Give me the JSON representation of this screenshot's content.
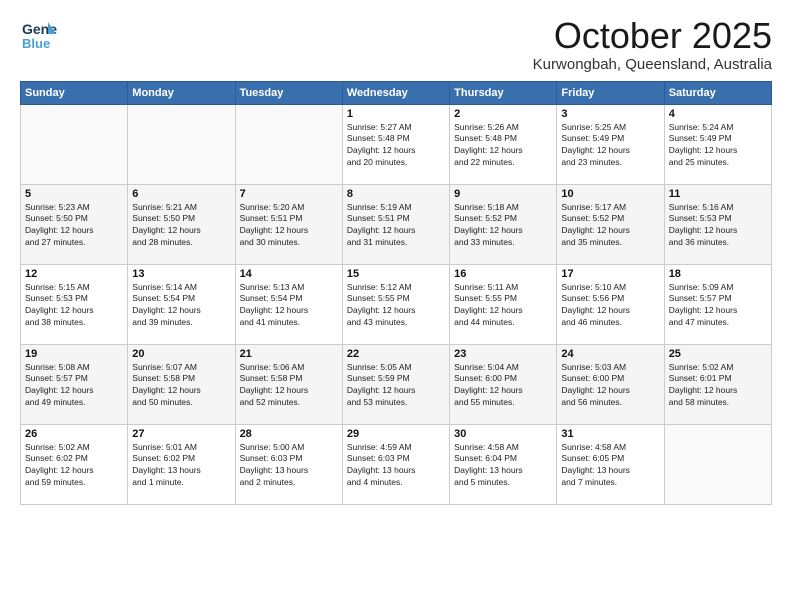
{
  "logo": {
    "general": "General",
    "blue": "Blue"
  },
  "title": "October 2025",
  "subtitle": "Kurwongbah, Queensland, Australia",
  "weekdays": [
    "Sunday",
    "Monday",
    "Tuesday",
    "Wednesday",
    "Thursday",
    "Friday",
    "Saturday"
  ],
  "weeks": [
    [
      {
        "day": "",
        "info": ""
      },
      {
        "day": "",
        "info": ""
      },
      {
        "day": "",
        "info": ""
      },
      {
        "day": "1",
        "info": "Sunrise: 5:27 AM\nSunset: 5:48 PM\nDaylight: 12 hours\nand 20 minutes."
      },
      {
        "day": "2",
        "info": "Sunrise: 5:26 AM\nSunset: 5:48 PM\nDaylight: 12 hours\nand 22 minutes."
      },
      {
        "day": "3",
        "info": "Sunrise: 5:25 AM\nSunset: 5:49 PM\nDaylight: 12 hours\nand 23 minutes."
      },
      {
        "day": "4",
        "info": "Sunrise: 5:24 AM\nSunset: 5:49 PM\nDaylight: 12 hours\nand 25 minutes."
      }
    ],
    [
      {
        "day": "5",
        "info": "Sunrise: 5:23 AM\nSunset: 5:50 PM\nDaylight: 12 hours\nand 27 minutes."
      },
      {
        "day": "6",
        "info": "Sunrise: 5:21 AM\nSunset: 5:50 PM\nDaylight: 12 hours\nand 28 minutes."
      },
      {
        "day": "7",
        "info": "Sunrise: 5:20 AM\nSunset: 5:51 PM\nDaylight: 12 hours\nand 30 minutes."
      },
      {
        "day": "8",
        "info": "Sunrise: 5:19 AM\nSunset: 5:51 PM\nDaylight: 12 hours\nand 31 minutes."
      },
      {
        "day": "9",
        "info": "Sunrise: 5:18 AM\nSunset: 5:52 PM\nDaylight: 12 hours\nand 33 minutes."
      },
      {
        "day": "10",
        "info": "Sunrise: 5:17 AM\nSunset: 5:52 PM\nDaylight: 12 hours\nand 35 minutes."
      },
      {
        "day": "11",
        "info": "Sunrise: 5:16 AM\nSunset: 5:53 PM\nDaylight: 12 hours\nand 36 minutes."
      }
    ],
    [
      {
        "day": "12",
        "info": "Sunrise: 5:15 AM\nSunset: 5:53 PM\nDaylight: 12 hours\nand 38 minutes."
      },
      {
        "day": "13",
        "info": "Sunrise: 5:14 AM\nSunset: 5:54 PM\nDaylight: 12 hours\nand 39 minutes."
      },
      {
        "day": "14",
        "info": "Sunrise: 5:13 AM\nSunset: 5:54 PM\nDaylight: 12 hours\nand 41 minutes."
      },
      {
        "day": "15",
        "info": "Sunrise: 5:12 AM\nSunset: 5:55 PM\nDaylight: 12 hours\nand 43 minutes."
      },
      {
        "day": "16",
        "info": "Sunrise: 5:11 AM\nSunset: 5:55 PM\nDaylight: 12 hours\nand 44 minutes."
      },
      {
        "day": "17",
        "info": "Sunrise: 5:10 AM\nSunset: 5:56 PM\nDaylight: 12 hours\nand 46 minutes."
      },
      {
        "day": "18",
        "info": "Sunrise: 5:09 AM\nSunset: 5:57 PM\nDaylight: 12 hours\nand 47 minutes."
      }
    ],
    [
      {
        "day": "19",
        "info": "Sunrise: 5:08 AM\nSunset: 5:57 PM\nDaylight: 12 hours\nand 49 minutes."
      },
      {
        "day": "20",
        "info": "Sunrise: 5:07 AM\nSunset: 5:58 PM\nDaylight: 12 hours\nand 50 minutes."
      },
      {
        "day": "21",
        "info": "Sunrise: 5:06 AM\nSunset: 5:58 PM\nDaylight: 12 hours\nand 52 minutes."
      },
      {
        "day": "22",
        "info": "Sunrise: 5:05 AM\nSunset: 5:59 PM\nDaylight: 12 hours\nand 53 minutes."
      },
      {
        "day": "23",
        "info": "Sunrise: 5:04 AM\nSunset: 6:00 PM\nDaylight: 12 hours\nand 55 minutes."
      },
      {
        "day": "24",
        "info": "Sunrise: 5:03 AM\nSunset: 6:00 PM\nDaylight: 12 hours\nand 56 minutes."
      },
      {
        "day": "25",
        "info": "Sunrise: 5:02 AM\nSunset: 6:01 PM\nDaylight: 12 hours\nand 58 minutes."
      }
    ],
    [
      {
        "day": "26",
        "info": "Sunrise: 5:02 AM\nSunset: 6:02 PM\nDaylight: 12 hours\nand 59 minutes."
      },
      {
        "day": "27",
        "info": "Sunrise: 5:01 AM\nSunset: 6:02 PM\nDaylight: 13 hours\nand 1 minute."
      },
      {
        "day": "28",
        "info": "Sunrise: 5:00 AM\nSunset: 6:03 PM\nDaylight: 13 hours\nand 2 minutes."
      },
      {
        "day": "29",
        "info": "Sunrise: 4:59 AM\nSunset: 6:03 PM\nDaylight: 13 hours\nand 4 minutes."
      },
      {
        "day": "30",
        "info": "Sunrise: 4:58 AM\nSunset: 6:04 PM\nDaylight: 13 hours\nand 5 minutes."
      },
      {
        "day": "31",
        "info": "Sunrise: 4:58 AM\nSunset: 6:05 PM\nDaylight: 13 hours\nand 7 minutes."
      },
      {
        "day": "",
        "info": ""
      }
    ]
  ]
}
